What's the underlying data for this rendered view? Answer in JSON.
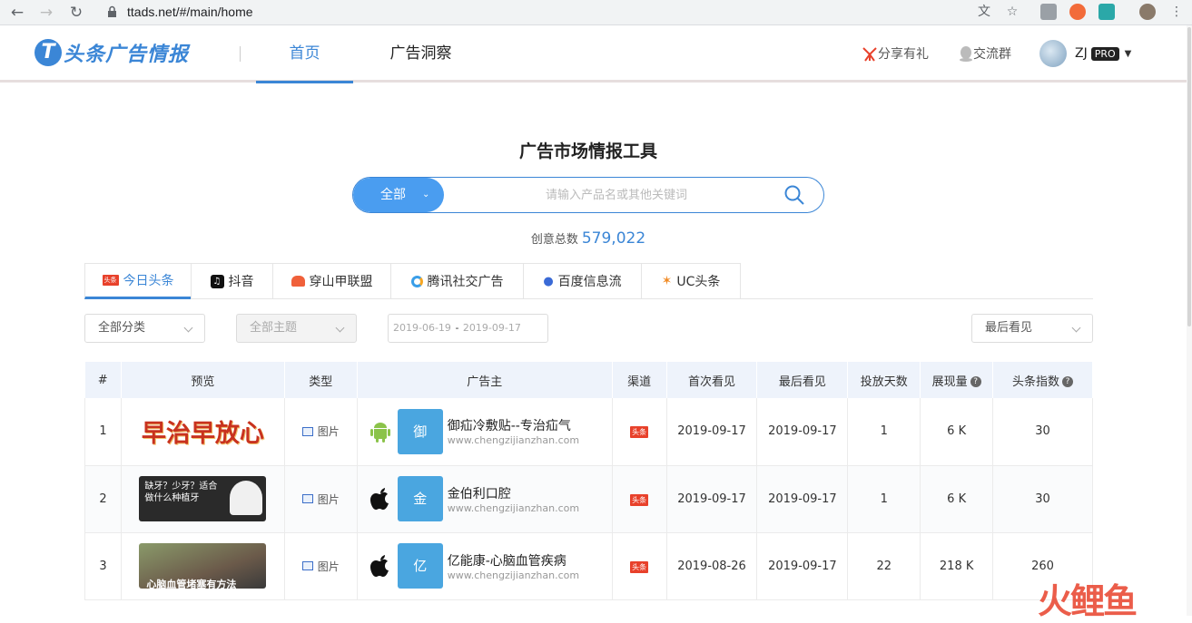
{
  "browser": {
    "url": "ttads.net/#/main/home"
  },
  "header": {
    "logo_text": "头条广告情报",
    "nav": [
      {
        "label": "首页"
      },
      {
        "label": "广告洞察"
      }
    ],
    "share_label": "分享有礼",
    "group_label": "交流群",
    "user_name": "ZJ",
    "pro_label": "PRO"
  },
  "main": {
    "title": "广告市场情报工具",
    "search_category": "全部",
    "search_placeholder": "请输入产品名或其他关键词",
    "total_label": "创意总数",
    "total_value": "579,022"
  },
  "tabs": [
    {
      "label": "今日头条"
    },
    {
      "label": "抖音"
    },
    {
      "label": "穿山甲联盟"
    },
    {
      "label": "腾讯社交广告"
    },
    {
      "label": "百度信息流"
    },
    {
      "label": "UC头条"
    }
  ],
  "filters": {
    "category": "全部分类",
    "theme": "全部主题",
    "date_start": "2019-06-19",
    "date_sep": "-",
    "date_end": "2019-09-17",
    "sort": "最后看见"
  },
  "table": {
    "headers": [
      "#",
      "预览",
      "类型",
      "广告主",
      "渠道",
      "首次看见",
      "最后看见",
      "投放天数",
      "展现量",
      "头条指数"
    ],
    "rows": [
      {
        "idx": "1",
        "preview_text": "早治早放心",
        "type": "图片",
        "os": "android",
        "char": "御",
        "name": "御疝冷敷贴--专治疝气",
        "site": "www.chengzijianzhan.com",
        "channel": "头条",
        "first": "2019-09-17",
        "last": "2019-09-17",
        "days": "1",
        "views": "6 K",
        "index": "30"
      },
      {
        "idx": "2",
        "preview_text": "缺牙？少牙？适合做什么种植牙",
        "type": "图片",
        "os": "ios",
        "char": "金",
        "name": "金伯利口腔",
        "site": "www.chengzijianzhan.com",
        "channel": "头条",
        "first": "2019-09-17",
        "last": "2019-09-17",
        "days": "1",
        "views": "6 K",
        "index": "30"
      },
      {
        "idx": "3",
        "preview_text": "心脑血管堵塞有方法",
        "type": "图片",
        "os": "ios",
        "char": "亿",
        "name": "亿能康-心脑血管疾病",
        "site": "www.chengzijianzhan.com",
        "channel": "头条",
        "first": "2019-08-26",
        "last": "2019-09-17",
        "days": "22",
        "views": "218 K",
        "index": "260"
      }
    ]
  },
  "watermark": "火鲤鱼",
  "colors": {
    "accent": "#3b86d6",
    "header_bg": "#eef3fb",
    "channel": "#e8412b"
  }
}
